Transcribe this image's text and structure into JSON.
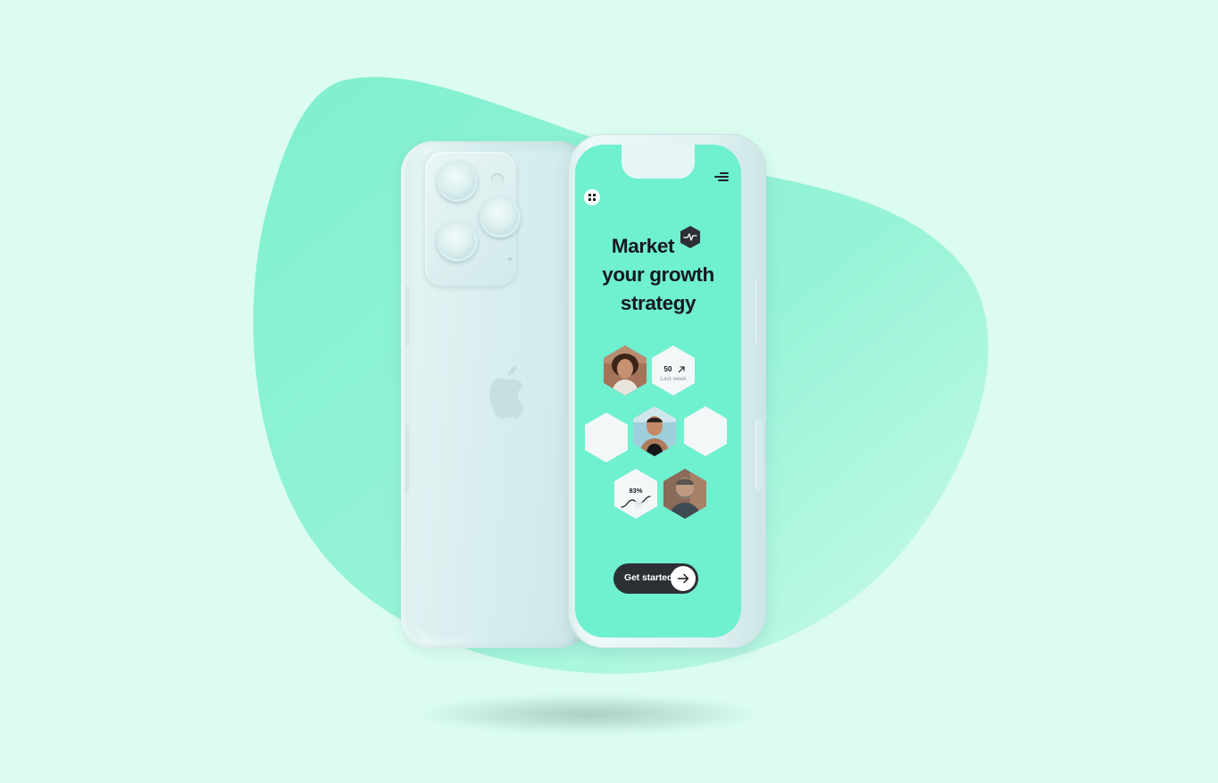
{
  "colors": {
    "background": "#dcfcf1",
    "blob": "#7ff0cf",
    "accent": "#6ff0cf",
    "dark": "#2c3034"
  },
  "icons": [
    "apple-logo-icon",
    "grid-logo-icon",
    "menu-icon",
    "pulse-icon",
    "arrow-up-right-icon",
    "trend-line-icon",
    "arrow-right-icon"
  ],
  "app": {
    "headline": [
      "Market",
      "your growth",
      "strategy"
    ],
    "stats": {
      "value": "50",
      "label": "Last week"
    },
    "progress": {
      "value": "83%"
    },
    "cta": {
      "label": "Get started"
    }
  }
}
